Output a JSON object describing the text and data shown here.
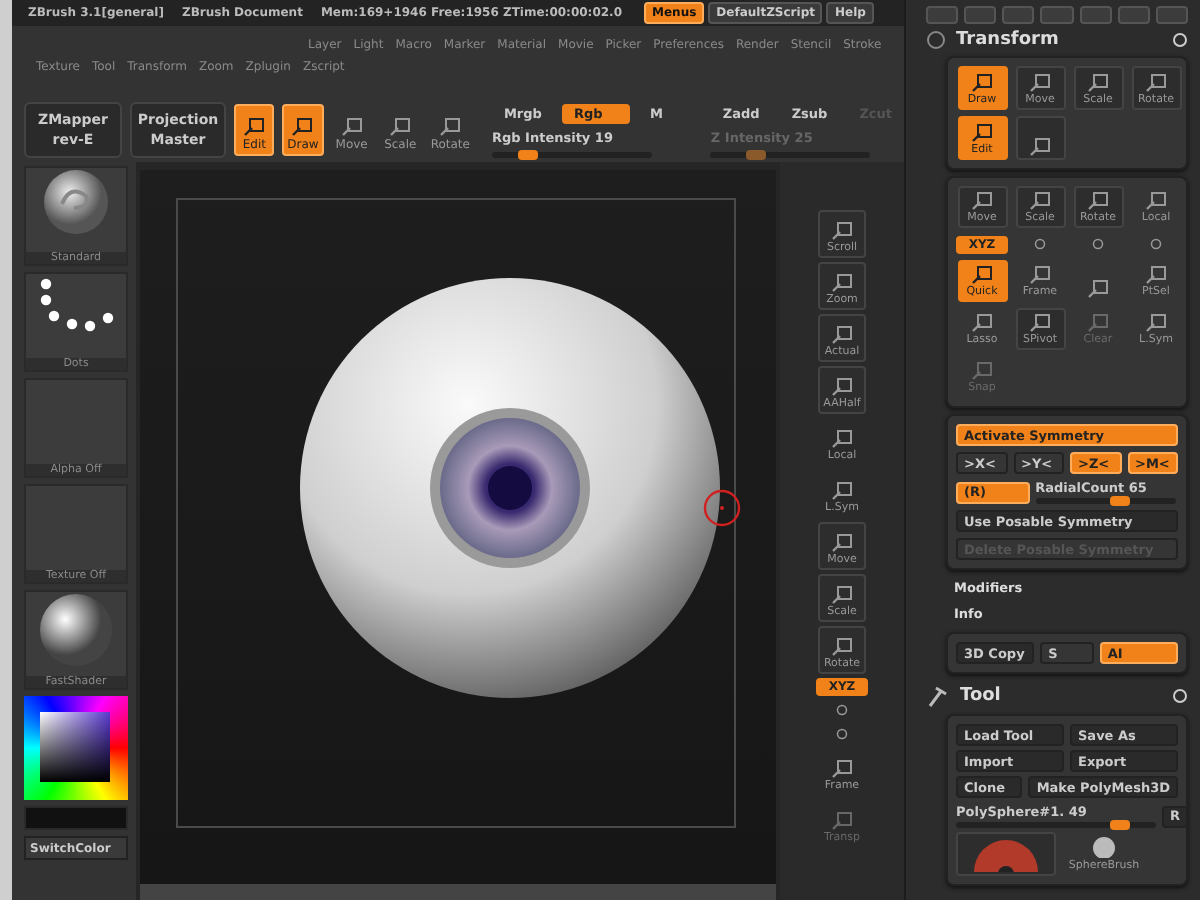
{
  "title_bar": {
    "app": "ZBrush 3.1[general]",
    "document": "ZBrush Document",
    "stats": "Mem:169+1946 Free:1956 ZTime:00:00:02.0",
    "buttons": [
      {
        "label": "Menus",
        "selected": true
      },
      {
        "label": "DefaultZScript",
        "selected": false
      },
      {
        "label": "Help",
        "selected": false
      }
    ]
  },
  "menu_rows": [
    [
      "Layer",
      "Light",
      "Macro",
      "Marker",
      "Material",
      "Movie",
      "Picker",
      "Preferences",
      "Render",
      "Stencil",
      "Stroke"
    ],
    [
      "Texture",
      "Tool",
      "Transform",
      "Zoom",
      "Zplugin",
      "Zscript"
    ]
  ],
  "toolbar": {
    "plugins": [
      {
        "label": "ZMapper",
        "sub": "rev-E"
      },
      {
        "label": "Projection",
        "sub": "Master"
      }
    ],
    "modes": [
      {
        "label": "Edit",
        "selected": true
      },
      {
        "label": "Draw",
        "selected": true
      },
      {
        "label": "Move",
        "selected": false
      },
      {
        "label": "Scale",
        "selected": false
      },
      {
        "label": "Rotate",
        "selected": false
      }
    ],
    "rgb_toggles": [
      {
        "label": "Mrgb",
        "selected": false
      },
      {
        "label": "Rgb",
        "selected": true
      },
      {
        "label": "M",
        "selected": false
      }
    ],
    "rgb_intensity": {
      "label": "Rgb Intensity 19",
      "level": 0.19,
      "disabled": false
    },
    "z_toggles": [
      {
        "label": "Zadd",
        "selected": false,
        "disabled": false
      },
      {
        "label": "Zsub",
        "selected": false,
        "disabled": false
      },
      {
        "label": "Zcut",
        "selected": false,
        "disabled": true
      }
    ],
    "z_intensity": {
      "label": "Z Intensity 25",
      "level": 0.25,
      "disabled": true
    }
  },
  "left_shelf": {
    "slots": [
      {
        "label": "Standard",
        "kind": "brush"
      },
      {
        "label": "Dots",
        "kind": "stroke"
      },
      {
        "label": "Alpha Off",
        "kind": "empty"
      },
      {
        "label": "Texture Off",
        "kind": "empty"
      },
      {
        "label": "FastShader",
        "kind": "material"
      }
    ],
    "switch_button": "SwitchColor"
  },
  "right_shelf": [
    {
      "kind": "tool",
      "label": "Scroll",
      "selected": false,
      "disabled": false
    },
    {
      "kind": "tool",
      "label": "Zoom",
      "selected": false,
      "disabled": false
    },
    {
      "kind": "tool",
      "label": "Actual",
      "selected": false,
      "disabled": false
    },
    {
      "kind": "tool",
      "label": "AAHalf",
      "selected": false,
      "disabled": false
    },
    {
      "kind": "flat",
      "label": "Local",
      "selected": false,
      "disabled": false
    },
    {
      "kind": "flat",
      "label": "L.Sym",
      "selected": false,
      "disabled": false
    },
    {
      "kind": "tool",
      "label": "Move",
      "selected": false,
      "disabled": false
    },
    {
      "kind": "tool",
      "label": "Scale",
      "selected": false,
      "disabled": false
    },
    {
      "kind": "tool",
      "label": "Rotate",
      "selected": false,
      "disabled": false
    },
    {
      "kind": "strip",
      "label": "XYZ",
      "selected": true
    },
    {
      "kind": "axis",
      "selected": false
    },
    {
      "kind": "axis",
      "selected": false
    },
    {
      "kind": "flat",
      "label": "Frame",
      "selected": false,
      "disabled": false
    },
    {
      "kind": "flat",
      "label": "Transp",
      "selected": false,
      "disabled": true
    }
  ],
  "panel": {
    "transform": {
      "title": "Transform",
      "modes": [
        {
          "label": "Draw",
          "selected": true
        },
        {
          "label": "Move",
          "selected": false
        },
        {
          "label": "Scale",
          "selected": false
        },
        {
          "label": "Rotate",
          "selected": false
        },
        {
          "label": "Edit",
          "selected": true
        },
        {
          "selected": false
        }
      ],
      "tools": [
        {
          "kind": "tool",
          "label": "Move",
          "selected": false,
          "disabled": false
        },
        {
          "kind": "tool",
          "label": "Scale",
          "selected": false,
          "disabled": false
        },
        {
          "kind": "tool",
          "label": "Rotate",
          "selected": false,
          "disabled": false
        },
        {
          "kind": "flat",
          "label": "Local",
          "selected": false,
          "disabled": false
        },
        {
          "kind": "strip",
          "label": "XYZ",
          "selected": true
        },
        {
          "kind": "axis",
          "selected": false
        },
        {
          "kind": "axis",
          "selected": false
        },
        {
          "kind": "axis",
          "selected": false
        },
        {
          "kind": "tool",
          "label": "Quick",
          "selected": true,
          "disabled": false
        },
        {
          "kind": "flat",
          "label": "Frame",
          "selected": false,
          "disabled": false
        },
        {
          "kind": "flat",
          "selected": false,
          "disabled": false
        },
        {
          "kind": "flat",
          "label": "PtSel",
          "selected": false,
          "disabled": false
        },
        {
          "kind": "flat",
          "label": "Lasso",
          "selected": false,
          "disabled": false
        },
        {
          "kind": "tool",
          "label": "SPivot",
          "selected": false,
          "disabled": false
        },
        {
          "kind": "flat",
          "label": "Clear",
          "selected": false,
          "disabled": true
        },
        {
          "kind": "flat",
          "label": "L.Sym",
          "selected": false,
          "disabled": false
        },
        {
          "kind": "flat",
          "label": "Snap",
          "selected": false,
          "disabled": true
        }
      ],
      "symmetry": {
        "activate": {
          "label": "Activate Symmetry",
          "selected": true
        },
        "axes": [
          {
            "label": ">X<",
            "selected": false
          },
          {
            "label": ">Y<",
            "selected": false
          },
          {
            "label": ">Z<",
            "selected": true
          },
          {
            "label": ">M<",
            "selected": true
          }
        ],
        "radial": {
          "label": "(R)",
          "selected": true
        },
        "radial_count": {
          "label": "RadialCount 65",
          "level": 0.62
        },
        "posable": {
          "label": "Use Posable Symmetry",
          "disabled": false
        },
        "delete_posable": {
          "label": "Delete Posable Symmetry",
          "disabled": true
        }
      },
      "sections": [
        "Modifiers",
        "Info"
      ],
      "copy_row": [
        {
          "label": "3D Copy",
          "selected": false
        },
        {
          "label": "S",
          "selected": false
        },
        {
          "label": "AI",
          "selected": true
        }
      ]
    },
    "tool": {
      "title": "Tool",
      "buttons": [
        [
          "Load Tool",
          "Save As"
        ],
        [
          "Import",
          "Export"
        ],
        [
          "Clone",
          "Make PolyMesh3D"
        ]
      ],
      "subtool": {
        "label": "PolySphere#1. 49",
        "level": 0.85,
        "reset": "R"
      },
      "thumbs": [
        {
          "kind": "eye"
        },
        {
          "kind": "sphere",
          "label": "SphereBrush"
        }
      ]
    }
  }
}
